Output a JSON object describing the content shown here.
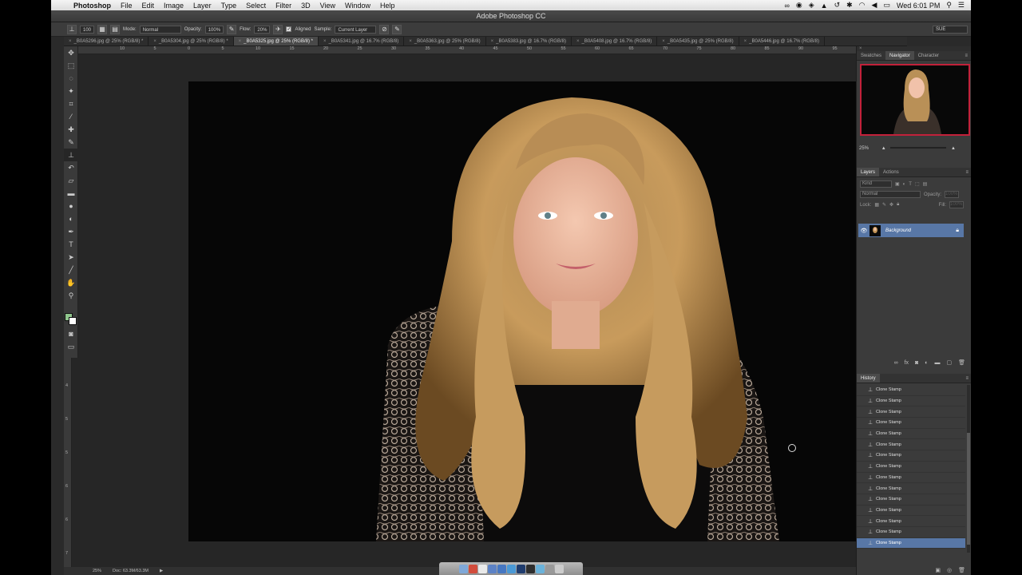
{
  "menubar": {
    "apple": "",
    "items": [
      "Photoshop",
      "File",
      "Edit",
      "Image",
      "Layer",
      "Type",
      "Select",
      "Filter",
      "3D",
      "View",
      "Window",
      "Help"
    ],
    "clock": "Wed 6:01 PM"
  },
  "window": {
    "title": "Adobe Photoshop CC"
  },
  "options": {
    "brush_size": "100",
    "mode_label": "Mode:",
    "mode_value": "Normal",
    "opacity_label": "Opacity:",
    "opacity_value": "100%",
    "flow_label": "Flow:",
    "flow_value": "20%",
    "aligned_label": "Aligned",
    "sample_label": "Sample:",
    "sample_value": "Current Layer",
    "workspace": "SUE"
  },
  "tabs": [
    {
      "label": "_B0A5296.jpg @ 25% (RGB/8) *"
    },
    {
      "label": "_B0A5304.jpg @ 25% (RGB/8) *"
    },
    {
      "label": "_B0A5325.jpg @ 25% (RGB/8) *"
    },
    {
      "label": "_B0A5341.jpg @ 16.7% (RGB/8)"
    },
    {
      "label": "_B0A5363.jpg @ 25% (RGB/8)"
    },
    {
      "label": "_B0A5383.jpg @ 16.7% (RGB/8)"
    },
    {
      "label": "_B0A5408.jpg @ 16.7% (RGB/8)"
    },
    {
      "label": "_B0A5435.jpg @ 25% (RGB/8)"
    },
    {
      "label": "_B0A5446.jpg @ 16.7% (RGB/8)"
    }
  ],
  "ruler_top": [
    "10",
    "5",
    "0",
    "5",
    "10",
    "15",
    "20",
    "25",
    "30",
    "35",
    "40",
    "45",
    "50",
    "55",
    "60",
    "65",
    "70",
    "75",
    "80",
    "85",
    "90",
    "95"
  ],
  "ruler_left": [
    "0",
    "5",
    "1",
    "1",
    "2",
    "2",
    "3",
    "3",
    "4",
    "4",
    "5",
    "5",
    "6",
    "6",
    "7"
  ],
  "panels": {
    "navigator_tabs": [
      "Swatches",
      "Navigator",
      "Character"
    ],
    "navigator_zoom": "25%",
    "layers_tabs": [
      "Layers",
      "Actions"
    ],
    "layer_kind": "Kind",
    "blend_mode": "Normal",
    "opacity_label": "Opacity:",
    "opacity_value": "100%",
    "lock_label": "Lock:",
    "fill_label": "Fill:",
    "fill_value": "100%",
    "layer_name": "Background",
    "history_title": "History",
    "history_items": [
      "Clone Stamp",
      "Clone Stamp",
      "Clone Stamp",
      "Clone Stamp",
      "Clone Stamp",
      "Clone Stamp",
      "Clone Stamp",
      "Clone Stamp",
      "Clone Stamp",
      "Clone Stamp",
      "Clone Stamp",
      "Clone Stamp",
      "Clone Stamp",
      "Clone Stamp",
      "Clone Stamp"
    ]
  },
  "status": {
    "zoom": "25%",
    "doc": "Doc: 63.3M/63.3M"
  },
  "colors": {
    "foreground": "#8fc58c",
    "background": "#ffffff",
    "selection": "#5877a6",
    "navigator_frame": "#c2213a"
  }
}
